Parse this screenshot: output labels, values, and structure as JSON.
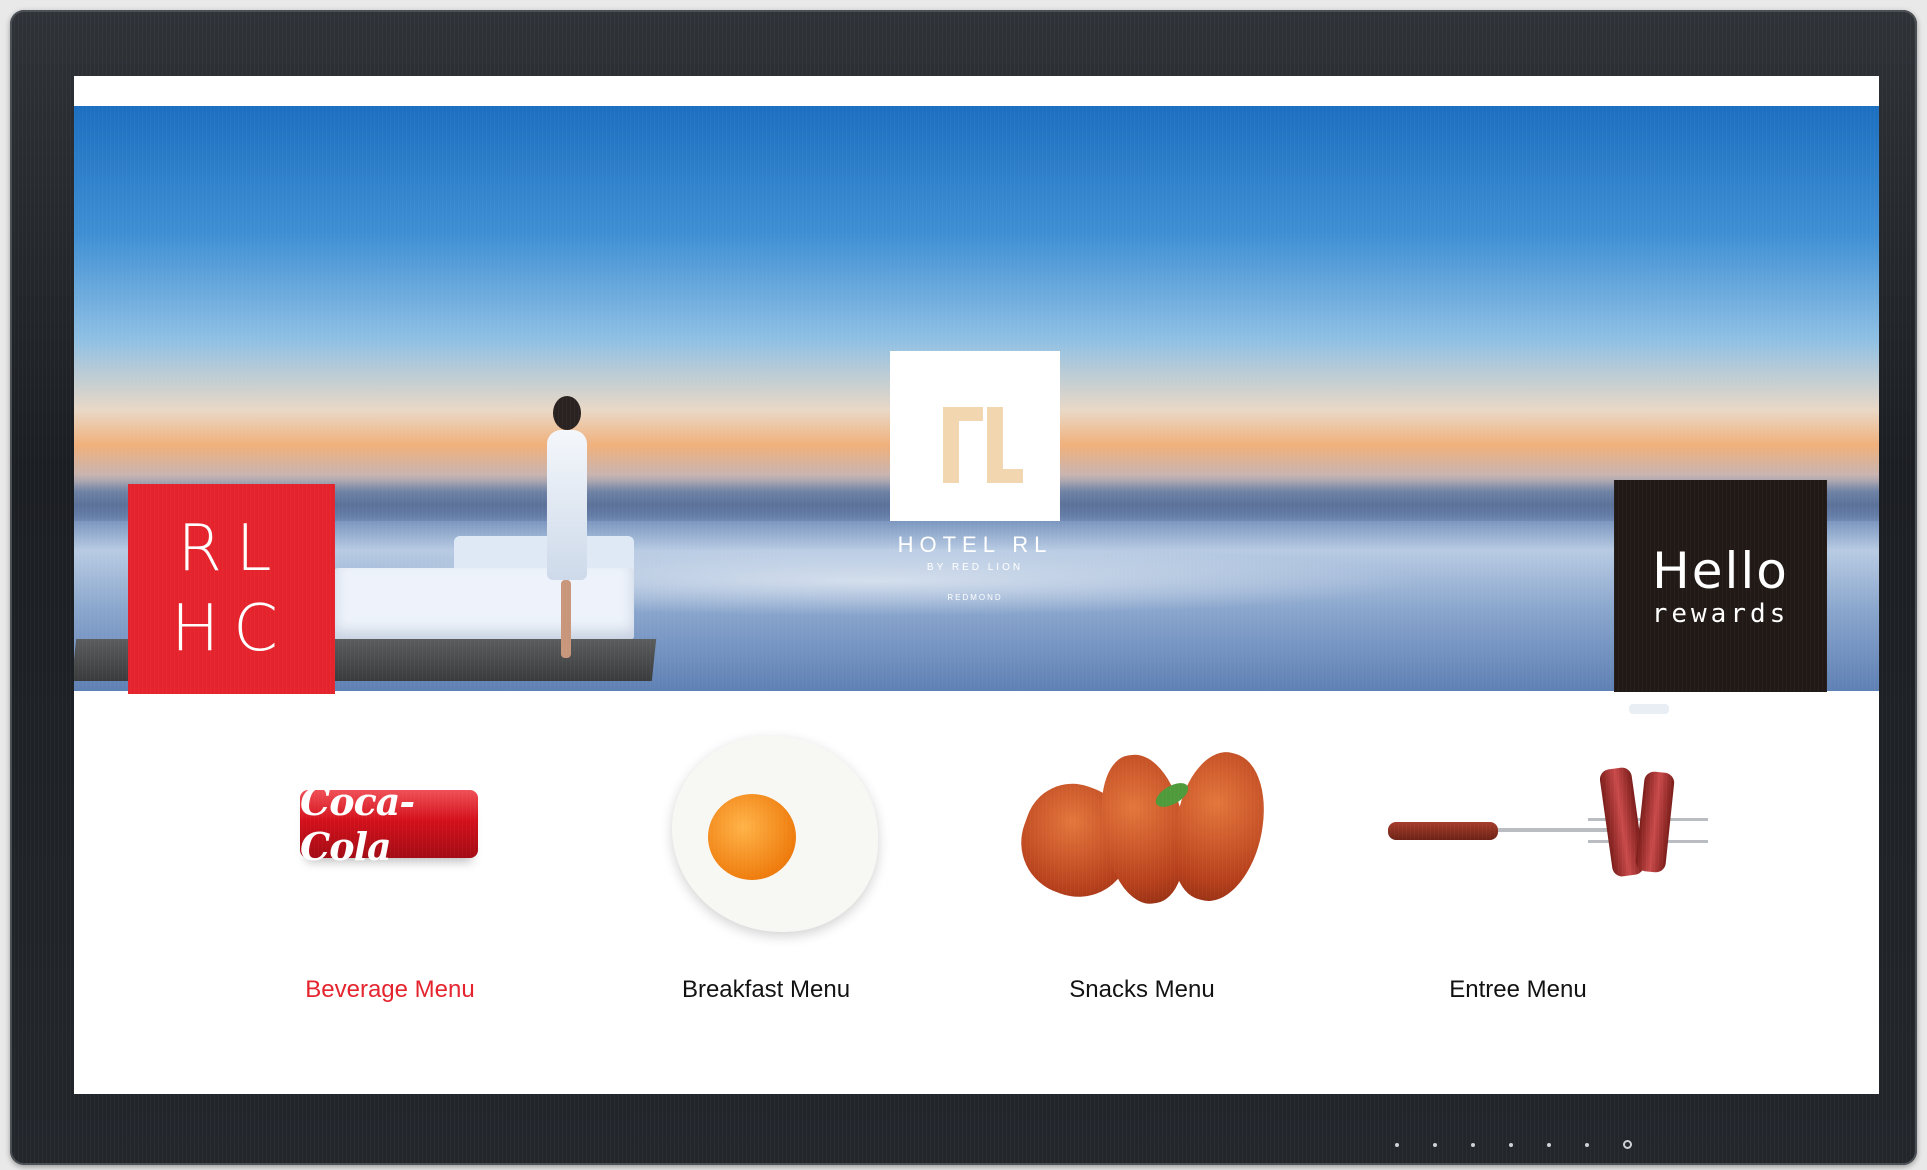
{
  "hero": {
    "left_tile": {
      "line1": "RL",
      "line2": "HC",
      "color": "#e4232d"
    },
    "logo": {
      "name": "HOTEL RL",
      "subtitle": "BY RED LION",
      "location": "REDMOND"
    },
    "right_tile": {
      "big": "Hello",
      "small": "rewards",
      "color": "#201915"
    }
  },
  "menu": {
    "items": [
      {
        "label": "Beverage Menu",
        "image": "coca-cola-can",
        "active": true
      },
      {
        "label": "Breakfast Menu",
        "image": "fried-egg",
        "active": false
      },
      {
        "label": "Snacks Menu",
        "image": "chicken-wings",
        "active": false
      },
      {
        "label": "Entree Menu",
        "image": "steak-on-fork",
        "active": false
      }
    ],
    "can_text": "Coca-Cola",
    "active_color": "#e4232d"
  },
  "device": {
    "controls": [
      "button",
      "button",
      "button",
      "button",
      "button",
      "button",
      "power-icon"
    ]
  }
}
